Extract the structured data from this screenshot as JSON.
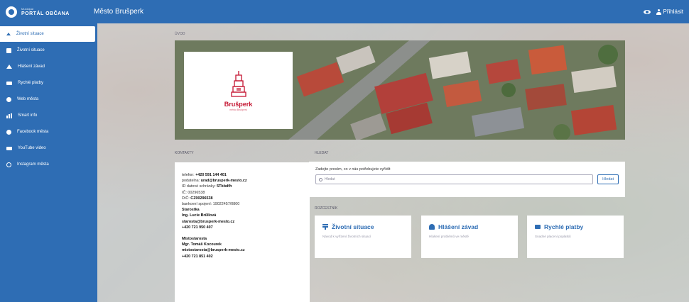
{
  "brand": {
    "small": "Municipal",
    "big": "PORTÁL OBČANA"
  },
  "header": {
    "title": "Město Brušperk",
    "login_label": "Přihlásit"
  },
  "sidebar": {
    "items": [
      {
        "label": "Životní situace",
        "icon": "home-icon"
      },
      {
        "label": "Životní situace",
        "icon": "square-icon"
      },
      {
        "label": "Hlášení závad",
        "icon": "warning-icon"
      },
      {
        "label": "Rychlé platby",
        "icon": "card-icon"
      },
      {
        "label": "Web města",
        "icon": "globe-icon"
      },
      {
        "label": "Smart info",
        "icon": "signal-icon"
      },
      {
        "label": "Facebook města",
        "icon": "facebook-icon"
      },
      {
        "label": "YouTube video",
        "icon": "youtube-icon"
      },
      {
        "label": "Instagram města",
        "icon": "instagram-icon"
      }
    ]
  },
  "main": {
    "breadcrumb": "ÚVOD",
    "logo": {
      "name": "Brušperk",
      "sub": "město Brušperk"
    },
    "contacts_label": "KONTAKTY",
    "contacts": {
      "phone_label": "telefon:",
      "phone": "+420 591 144 401",
      "email_label": "podatelna:",
      "email": "urad@brusperk-mesto.cz",
      "databox_label": "ID datové schránky:",
      "databox": "5Tbbdfh",
      "ico": "IČ: 00296538",
      "dic_label": "DIČ:",
      "dic": "CZ00296538",
      "bank": "bankovní spojení: 19022457/0800",
      "mayor_title": "Starostka",
      "mayor_name": "Ing. Lucie Brűllová",
      "mayor_email": "starosta@brusperk-mesto.cz",
      "mayor_phone": "+420 721 950 407",
      "deputy_title": "Místostarosta",
      "deputy_name": "Mgr. Tomáš Kocourek",
      "deputy_email": "mistostarosta@brusperk-mesto.cz",
      "deputy_phone": "+420 721 851 402"
    },
    "search_label": "HLEDAT",
    "search": {
      "hint": "Zadejte prosím, co v nás potřebujete vyřídit",
      "placeholder": "Hledat",
      "button": "Hledat"
    },
    "quick_label": "ROZCESTNÍK",
    "cards": [
      {
        "title": "Životní situace",
        "desc": "Návod k vyřízení životních situací"
      },
      {
        "title": "Hlášení závad",
        "desc": "Hlášení problémů ve městě"
      },
      {
        "title": "Rychlé platby",
        "desc": "Snadné placení poplatků"
      }
    ]
  },
  "colors": {
    "accent": "#2e6db4",
    "logo_red": "#c4122f"
  }
}
